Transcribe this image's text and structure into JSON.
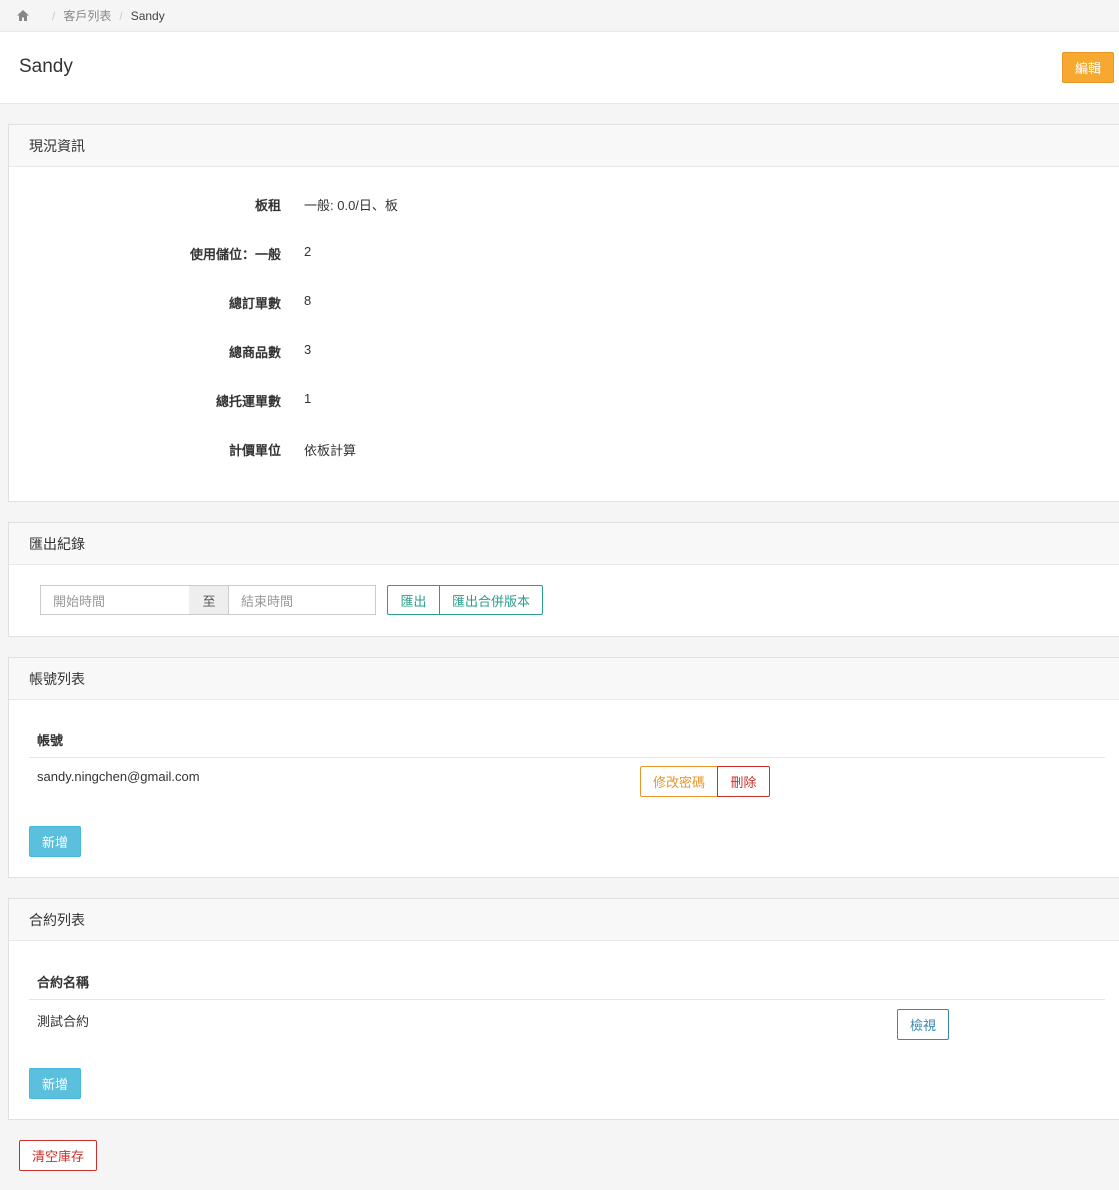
{
  "breadcrumb": {
    "items": [
      "客戶列表",
      "Sandy"
    ]
  },
  "header": {
    "title": "Sandy",
    "edit_label": "編輯"
  },
  "status_panel": {
    "title": "現況資訊",
    "rows": [
      {
        "label": "板租",
        "value": "一般: 0.0/日、板"
      },
      {
        "label": "使用儲位：一般",
        "value": "2"
      },
      {
        "label": "總訂單數",
        "value": "8"
      },
      {
        "label": "總商品數",
        "value": "3"
      },
      {
        "label": "總托運單數",
        "value": "1"
      },
      {
        "label": "計價單位",
        "value": "依板計算"
      }
    ]
  },
  "export_panel": {
    "title": "匯出紀錄",
    "start_placeholder": "開始時間",
    "to_label": "至",
    "end_placeholder": "結束時間",
    "export_label": "匯出",
    "export_merged_label": "匯出合併版本"
  },
  "account_panel": {
    "title": "帳號列表",
    "column_header": "帳號",
    "rows": [
      {
        "account": "sandy.ningchen@gmail.com",
        "change_password_label": "修改密碼",
        "delete_label": "刪除"
      }
    ],
    "add_label": "新增"
  },
  "contract_panel": {
    "title": "合約列表",
    "column_header": "合約名稱",
    "rows": [
      {
        "name": "測試合約",
        "view_label": "檢視"
      }
    ],
    "add_label": "新增"
  },
  "clear_stock_label": "清空庫存"
}
